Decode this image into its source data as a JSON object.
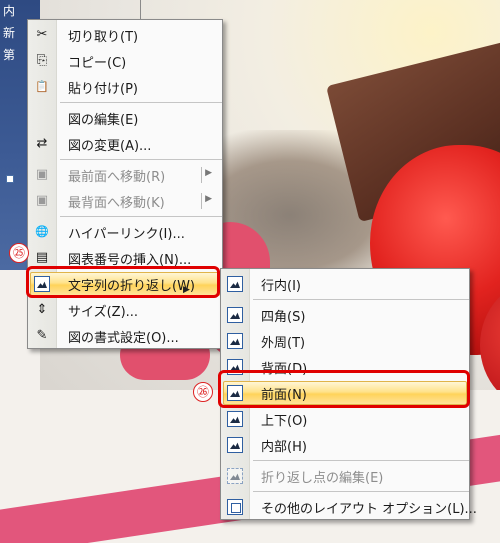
{
  "background": {
    "left_text_lines": [
      "内",
      "新",
      "第"
    ]
  },
  "context_menu": {
    "items": [
      {
        "label": "切り取り(T)",
        "icon": "scissors-icon",
        "glyph": "✂"
      },
      {
        "label": "コピー(C)",
        "icon": "copy-icon",
        "glyph": "⎘"
      },
      {
        "label": "貼り付け(P)",
        "icon": "paste-icon",
        "glyph": "📋"
      },
      {
        "label": "図の編集(E)"
      },
      {
        "label": "図の変更(A)...",
        "icon": "change-picture-icon",
        "glyph": "⇄"
      },
      {
        "label": "最前面へ移動(R)",
        "icon": "bring-to-front-icon",
        "glyph": "▣"
      },
      {
        "label": "最背面へ移動(K)",
        "icon": "send-to-back-icon",
        "glyph": "▣"
      },
      {
        "label": "ハイパーリンク(I)...",
        "icon": "hyperlink-icon",
        "glyph": "🌐"
      },
      {
        "label": "図表番号の挿入(N)...",
        "icon": "caption-icon",
        "glyph": "▤"
      },
      {
        "label": "文字列の折り返し(W)",
        "icon": "text-wrap-icon"
      },
      {
        "label": "サイズ(Z)...",
        "icon": "size-icon",
        "glyph": "⇕"
      },
      {
        "label": "図の書式設定(O)...",
        "icon": "format-picture-icon",
        "glyph": "✎"
      }
    ]
  },
  "submenu": {
    "items": [
      {
        "label": "行内(I)"
      },
      {
        "label": "四角(S)"
      },
      {
        "label": "外周(T)"
      },
      {
        "label": "背面(D)"
      },
      {
        "label": "前面(N)"
      },
      {
        "label": "上下(O)"
      },
      {
        "label": "内部(H)"
      },
      {
        "label": "折り返し点の編集(E)"
      },
      {
        "label": "その他のレイアウト オプション(L)..."
      }
    ]
  },
  "callouts": {
    "step_25": "㉕",
    "step_26": "㉖"
  },
  "colors": {
    "highlight_box": "#e00000",
    "menu_highlight": "#ffd35a"
  }
}
